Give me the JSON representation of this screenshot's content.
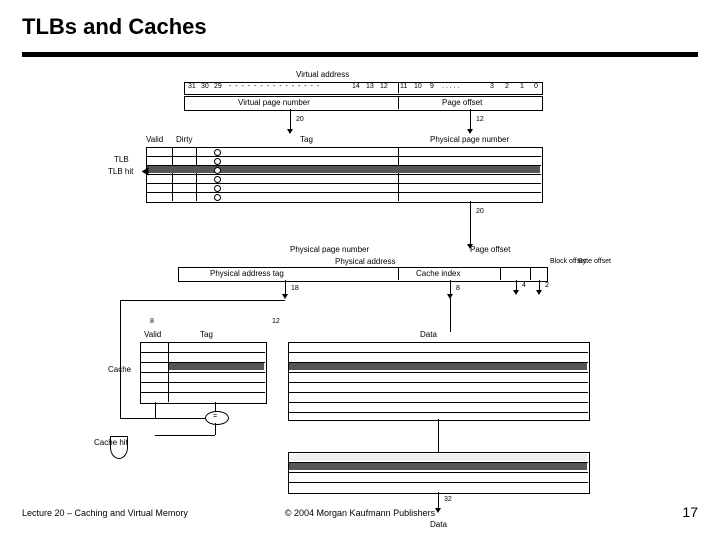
{
  "slide": {
    "title": "TLBs and Caches",
    "footer_left": "Lecture 20 – Caching and Virtual Memory",
    "footer_center": "© 2004 Morgan Kaufmann Publishers",
    "page_number": "17"
  },
  "diagram": {
    "top_header": "Virtual address",
    "section_vpn": "Virtual page number",
    "section_page_offset": "Page offset",
    "bit_31": "31",
    "bit_30": "30",
    "bit_29": "29",
    "bit_14": "14",
    "bit_13": "13",
    "bit_12": "12",
    "bit_11": "11",
    "bit_10": "10",
    "bit_9": "9",
    "bit_3": "3",
    "bit_2": "2",
    "bit_1": "1",
    "bit_0": "0",
    "dots1": "- - - - - - - - - - - - - - -",
    "dots2": ". . . . .",
    "width_20": "20",
    "width_12": "12",
    "width_32": "32",
    "width_18": "18",
    "width_8_a": "8",
    "width_8_b": "8",
    "width_4": "4",
    "width_2": "2",
    "tlb_valid": "Valid",
    "tlb_dirty": "Dirty",
    "tlb_tag": "Tag",
    "tlb_ppn": "Physical page number",
    "tlb_label": "TLB",
    "tlb_hit": "TLB hit",
    "pa_label_ppn": "Physical page number",
    "pa_label_po": "Page offset",
    "pa_header": "Physical address",
    "pa_tag": "Physical address tag",
    "pa_cache_index": "Cache index",
    "pa_block_offset": "Block offset",
    "pa_byte_offset": "Byte offset",
    "cache_valid": "Valid",
    "cache_tag": "Tag",
    "cache_data": "Data",
    "cache_label": "Cache",
    "cache_hit": "Cache hit",
    "data_out": "Data"
  }
}
